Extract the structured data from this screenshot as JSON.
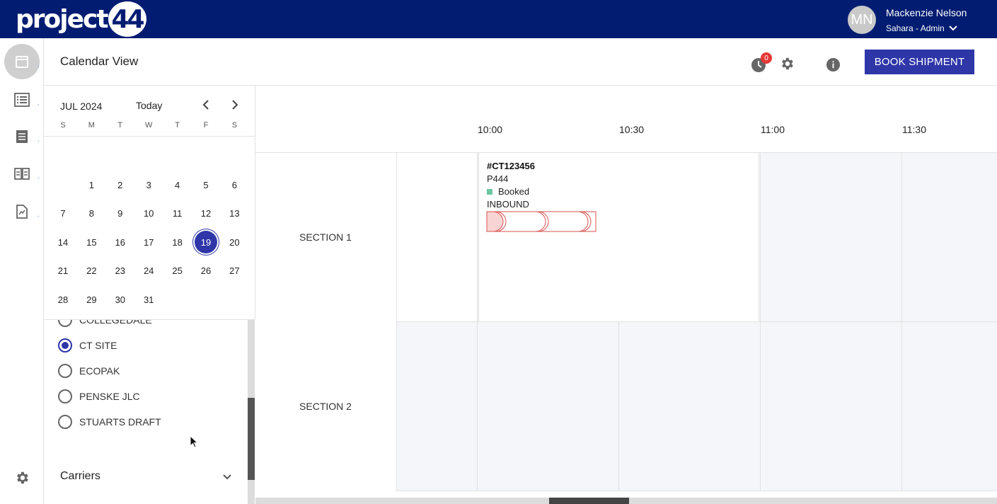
{
  "app": {
    "logo_text": "project",
    "logo_number": "44",
    "user_initials": "MN",
    "user_name": "Mackenzie Nelson",
    "user_role": "Sahara - Admin"
  },
  "rail": {
    "items": [
      {
        "icon": "calendar-icon",
        "active": true
      },
      {
        "icon": "list-icon",
        "active": false
      },
      {
        "icon": "document-icon",
        "active": false
      },
      {
        "icon": "book-icon",
        "active": false
      },
      {
        "icon": "report-icon",
        "active": false
      }
    ],
    "bottom_icon": "gear-icon"
  },
  "header": {
    "title": "Calendar View",
    "notification_count": "0",
    "book_button": "BOOK SHIPMENT"
  },
  "mini_calendar": {
    "month_label": "JUL 2024",
    "today_label": "Today",
    "weekdays": [
      "S",
      "M",
      "T",
      "W",
      "T",
      "F",
      "S"
    ],
    "weeks": [
      [
        "",
        "1",
        "2",
        "3",
        "4",
        "5",
        "6"
      ],
      [
        "7",
        "8",
        "9",
        "10",
        "11",
        "12",
        "13"
      ],
      [
        "14",
        "15",
        "16",
        "17",
        "18",
        "19",
        "20"
      ],
      [
        "21",
        "22",
        "23",
        "24",
        "25",
        "26",
        "27"
      ],
      [
        "28",
        "29",
        "30",
        "31",
        "",
        "",
        ""
      ]
    ],
    "selected_day": "19"
  },
  "sites": {
    "items": [
      {
        "label": "COLLEGEDALE",
        "selected": false
      },
      {
        "label": "CT SITE",
        "selected": true
      },
      {
        "label": "ECOPAK",
        "selected": false
      },
      {
        "label": "PENSKE JLC",
        "selected": false
      },
      {
        "label": "STUARTS DRAFT",
        "selected": false
      }
    ],
    "carriers_label": "Carriers"
  },
  "timeline": {
    "times": [
      "10:00",
      "10:30",
      "11:00",
      "11:30"
    ],
    "sections": [
      "SECTION 1",
      "SECTION 2"
    ],
    "event": {
      "id": "#CT123456",
      "code": "P444",
      "status": "Booked",
      "status_color": "#6cc7a0",
      "direction": "INBOUND"
    }
  },
  "colors": {
    "topbar": "#021c72",
    "accent": "#2e36a8",
    "badge": "#e53935"
  }
}
